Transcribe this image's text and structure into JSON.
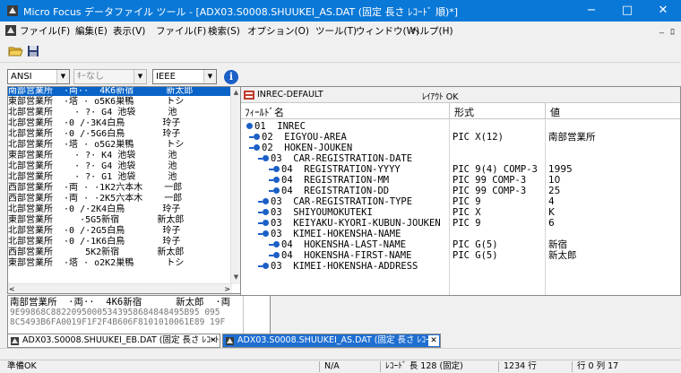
{
  "window": {
    "title": "Micro Focus データファイル ツール - [ADX03.S0008.SHUUKEI_AS.DAT (固定 長さ ﾚｺｰﾄﾞ 順)*]",
    "minimize": "−",
    "maximize": "□",
    "close": "✕"
  },
  "menu": {
    "items": [
      "ファイル(F)",
      "編集(E)",
      "表示(V)",
      "ファイル(F)",
      "検索(S)",
      "オプション(O)",
      "ツール(T)",
      "ウィンドウ(W)",
      "ヘルプ(H)"
    ],
    "mdi_min": "_",
    "mdi_restore": "ﾛ"
  },
  "options": {
    "charset": "ANSI",
    "key": "ｷｰなし",
    "float": "IEEE",
    "info": "i"
  },
  "left_pane": {
    "rows": [
      "南部営業所  ·両··  4K6新宿      新太郎",
      "東部営業所  ·塔 · o5K6巣鴨      トシ",
      "北部営業所    · ?· G4 池袋      池",
      "北部営業所  ·0 /·3K4白鳥       玲子",
      "北部営業所  ·0 /·5G6白鳥       玲子",
      "北部営業所  ·塔 · o5G2巣鴨      トシ",
      "東部営業所    · ?· K4 池袋      池",
      "北部営業所    · ?· G4 池袋      池",
      "北部営業所    · ?· G1 池袋      池",
      "西部営業所  ·両 · ·1K2六本木    一郎",
      "西部営業所  ·両 · ·2K5六本木    一郎",
      "北部営業所  ·0 /·2K4白鳥       玲子",
      "東部営業所     ·5G5新宿       新太郎",
      "北部営業所  ·0 /·2G5白鳥       玲子",
      "北部営業所  ·0 /·1K6白鳥       玲子",
      "西部営業所      5K2新宿       新太郎",
      "東部営業所  ·塔 · o2K2巣鴨      トシ"
    ],
    "scroll_up": "▲",
    "scroll_down": "▼",
    "scroll_left": "<",
    "scroll_right": ">"
  },
  "current_record": {
    "text": "南部営業所  ·両··  4K6新宿      新太郎  ·両",
    "hex1": "9E99868C88220950005343958684848495B95 095",
    "hex2": "8C5493B6FA0019F1F2F4B606F8101010061E89 19F"
  },
  "tabs": [
    {
      "label": "ADX03.S0008.SHUUKEI_EB.DAT (固定 長さ ﾚｺｰﾄﾞ順",
      "close": "✕"
    },
    {
      "label": "ADX03.S0008.SHUUKEI_AS.DAT (固定 長さ ﾚｺｰﾄﾞ",
      "close": "✕"
    }
  ],
  "record_layout": {
    "name": "INREC-DEFAULT",
    "layout_status": "ﾚｲｱｳﾄ OK",
    "col_field": "ﾌｨｰﾙﾄﾞ名",
    "col_format": "形式",
    "col_value": "値",
    "rows": [
      {
        "name": "01  INREC",
        "format": "",
        "value": ""
      },
      {
        "name": "02  EIGYOU-AREA",
        "format": "PIC X(12)",
        "value": "南部営業所"
      },
      {
        "name": "02  HOKEN-JOUKEN",
        "format": "",
        "value": ""
      },
      {
        "name": "03  CAR-REGISTRATION-DATE",
        "format": "",
        "value": ""
      },
      {
        "name": "04  REGISTRATION-YYYY",
        "format": "PIC 9(4) COMP-3",
        "value": "1995"
      },
      {
        "name": "04  REGISTRATION-MM",
        "format": "PIC 99 COMP-3",
        "value": "10"
      },
      {
        "name": "04  REGISTRATION-DD",
        "format": "PIC 99 COMP-3",
        "value": "25"
      },
      {
        "name": "03  CAR-REGISTRATION-TYPE",
        "format": "PIC 9",
        "value": "4"
      },
      {
        "name": "03  SHIYOUMOKUTEKI",
        "format": "PIC X",
        "value": "K"
      },
      {
        "name": "03  KEIYAKU-KYORI-KUBUN-JOUKEN",
        "format": "PIC 9",
        "value": "6"
      },
      {
        "name": "03  KIMEI-HOKENSHA-NAME",
        "format": "",
        "value": ""
      },
      {
        "name": "04  HOKENSHA-LAST-NAME",
        "format": "PIC G(5)",
        "value": "新宿"
      },
      {
        "name": "04  HOKENSHA-FIRST-NAME",
        "format": "PIC G(5)",
        "value": "新太郎"
      },
      {
        "name": "03  KIMEI-HOKENSHA-ADDRESS",
        "format": "",
        "value": ""
      }
    ]
  },
  "status": {
    "message": "準備OK",
    "mode": "N/A",
    "record_length": "ﾚｺｰﾄﾞ 長 128 (固定)",
    "rows": "1234 行",
    "position": "行 0 列 17"
  }
}
